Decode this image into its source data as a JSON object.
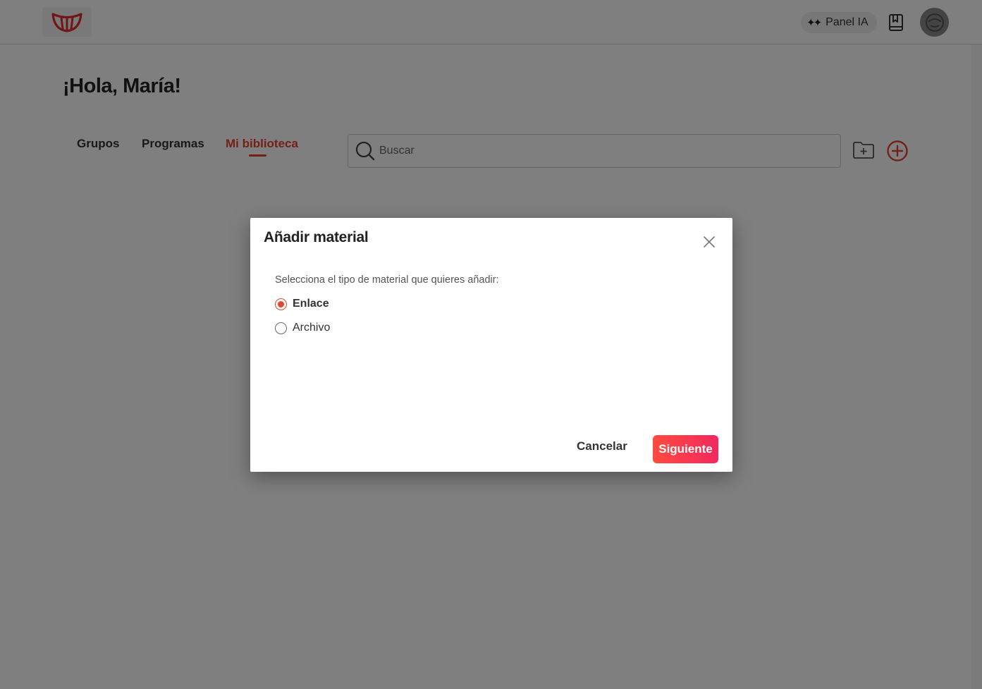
{
  "header": {
    "panel_ia_label": "Panel IA",
    "icons": {
      "logo": "smile-logo-icon",
      "sparkle": "sparkle-icon",
      "bookmark": "book-bookmark-icon",
      "avatar": "user-avatar-icon"
    }
  },
  "main": {
    "greeting": "¡Hola, María!",
    "tabs": [
      {
        "label": "Grupos",
        "active": false
      },
      {
        "label": "Programas",
        "active": false
      },
      {
        "label": "Mi biblioteca",
        "active": true
      }
    ],
    "search": {
      "placeholder": "Buscar",
      "value": ""
    },
    "icons": {
      "search": "search-icon",
      "new_folder": "folder-plus-icon",
      "add": "plus-circle-icon"
    }
  },
  "modal": {
    "title": "Añadir material",
    "prompt": "Selecciona el tipo de material que quieres añadir:",
    "options": [
      {
        "label": "Enlace",
        "selected": true
      },
      {
        "label": "Archivo",
        "selected": false
      }
    ],
    "cancel_label": "Cancelar",
    "next_label": "Siguiente",
    "close_icon": "close-icon"
  },
  "colors": {
    "accent": "#e7432f",
    "button_gradient_start": "#ff4b3e",
    "button_gradient_end": "#f2285f",
    "overlay": "rgba(0,0,0,0.5)"
  }
}
